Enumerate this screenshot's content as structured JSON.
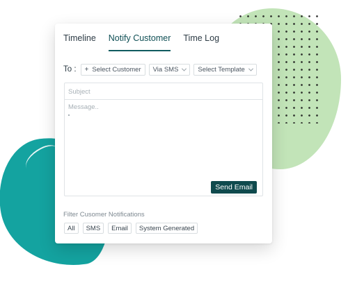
{
  "tabs": [
    {
      "label": "Timeline",
      "active": false
    },
    {
      "label": "Notify Customer",
      "active": true
    },
    {
      "label": "Time Log",
      "active": false
    }
  ],
  "recipient": {
    "to_label": "To :",
    "select_customer": "Select Customer",
    "channel": "Via SMS",
    "template": "Select Template"
  },
  "compose": {
    "subject_placeholder": "Subject",
    "message_placeholder": "Message..",
    "send_label": "Send Email"
  },
  "filters": {
    "label": "Filter Cusomer Notifications",
    "options": [
      "All",
      "SMS",
      "Email",
      "System Generated"
    ]
  },
  "colors": {
    "accent": "#0f4a4d",
    "teal_blob": "#14a3a0",
    "green_blob": "#bfe3b4"
  }
}
